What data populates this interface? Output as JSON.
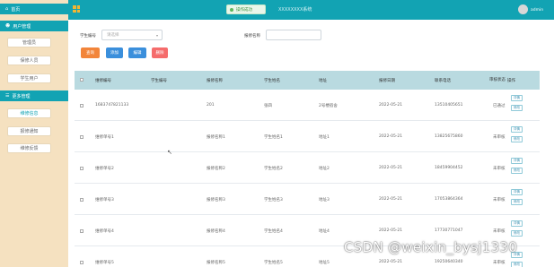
{
  "app": {
    "title": "XXXXXXXX系统",
    "user": "admin",
    "toast": "操作成功"
  },
  "sidebar": {
    "home": "首页",
    "groups": [
      {
        "label": "用户管理",
        "items": [
          "管理员",
          "保修人员",
          "学生用户"
        ]
      },
      {
        "label": "更多管理",
        "items": [
          "维修信息",
          "报修通知",
          "维修反馈"
        ]
      }
    ]
  },
  "search": {
    "student_no_label": "学生编号",
    "student_no_placeholder": "请选择",
    "item_name_label": "报修名称"
  },
  "buttons": {
    "query": "查询",
    "add": "添加",
    "edit": "编辑",
    "delete": "删除",
    "colors": {
      "query": "#f2853a",
      "add": "#3a8fdc",
      "edit": "#3a8fdc",
      "delete": "#f56c6c"
    }
  },
  "table": {
    "headers": [
      "维修编号",
      "学生编号",
      "报修名称",
      "学生姓名",
      "地址",
      "报修日期",
      "联系电话",
      "审核状态",
      "操作"
    ],
    "rows": [
      {
        "id": "1683747821133",
        "student_no": "",
        "name": "201",
        "student": "张四",
        "addr": "2号楼宿舍",
        "date": "2022-05-21",
        "phone": "13510405651",
        "status": "已通过"
      },
      {
        "id": "维修单号1",
        "student_no": "",
        "name": "报修名称1",
        "student": "学生姓名1",
        "addr": "地址1",
        "date": "2022-05-21",
        "phone": "13825675860",
        "status": "未审核"
      },
      {
        "id": "维修单号2",
        "student_no": "",
        "name": "报修名称2",
        "student": "学生姓名2",
        "addr": "地址2",
        "date": "2022-05-21",
        "phone": "18459904452",
        "status": "未审核"
      },
      {
        "id": "维修单号3",
        "student_no": "",
        "name": "报修名称3",
        "student": "学生姓名3",
        "addr": "地址3",
        "date": "2022-05-21",
        "phone": "17053864364",
        "status": "未审核"
      },
      {
        "id": "维修单号4",
        "student_no": "",
        "name": "报修名称4",
        "student": "学生姓名4",
        "addr": "地址4",
        "date": "2022-05-21",
        "phone": "17730771047",
        "status": "未审核"
      },
      {
        "id": "维修单号5",
        "student_no": "",
        "name": "报修名称5",
        "student": "学生姓名5",
        "addr": "地址5",
        "date": "2022-05-21",
        "phone": "19250640340",
        "status": "未审核"
      }
    ],
    "row_actions": [
      "详情",
      "修改"
    ]
  },
  "watermark": "CSDN @weixin_bysj1330"
}
